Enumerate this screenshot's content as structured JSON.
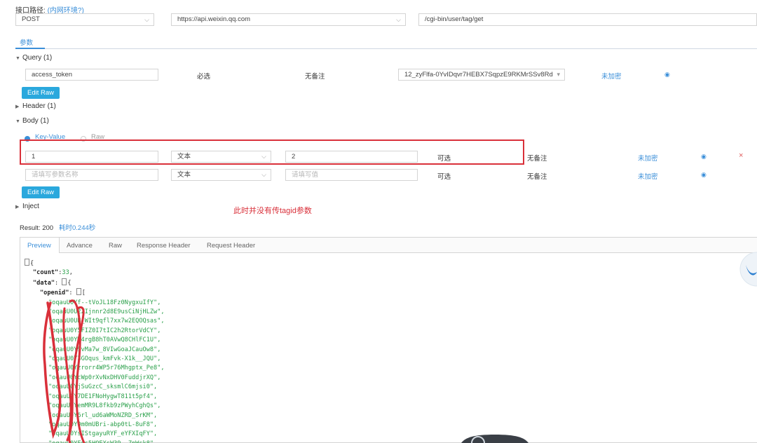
{
  "header": {
    "path_label": "接口路径:",
    "path_hint": "(内网环境?)",
    "method": "POST",
    "host": "https://api.weixin.qq.com",
    "path": "/cgi-bin/user/tag/get"
  },
  "tabs": {
    "params": "参数"
  },
  "query": {
    "title": "Query (1)",
    "param_name": "access_token",
    "required": "必选",
    "remark": "无备注",
    "value": "12_zyFlfa-0YvIDqvr7HEBX7SqpzE9RKMrSSv8Rd",
    "encrypt": "未加密",
    "edit_raw": "Edit Raw"
  },
  "header_section": {
    "title": "Header (1)"
  },
  "body": {
    "title": "Body (1)",
    "mode_kv": "Key-Value",
    "mode_raw": "Raw",
    "rows": [
      {
        "key": "1",
        "type": "文本",
        "value": "2",
        "optional": "可选",
        "remark": "无备注",
        "encrypt": "未加密",
        "delete": "×"
      }
    ],
    "empty_row": {
      "key_placeholder": "请填写参数名称",
      "type": "文本",
      "value_placeholder": "请填写值",
      "optional": "可选",
      "remark": "无备注",
      "encrypt": "未加密"
    },
    "edit_raw": "Edit Raw"
  },
  "inject": {
    "title": "Inject"
  },
  "annotation": "此时并没有传tagid参数",
  "result": {
    "label": "Result:",
    "code": "200",
    "time": "耗时0.244秒"
  },
  "panel_tabs": [
    "Preview",
    "Advance",
    "Raw",
    "Response Header",
    "Request Header"
  ],
  "response": {
    "count_key": "\"count\"",
    "count_value": "33",
    "data_key": "\"data\"",
    "openid_key": "\"openid\"",
    "openids": [
      "\"oqauU0Yf--tVoJL18Fz0NygxuIfY\",",
      "\"oqauU0U2ZIjnnr2d8E9usCiNjHLZw\",",
      "\"oqauU0UB_WIt9qfl7xx7w2EQOQsas\",",
      "\"oqauU0Y5FIZ0I7tIC2h2RtorVdCY\",",
      "\"oqauU0YM4rgB8hT0AVwQ8CHlFC1U\",",
      "\"oqauU0Y9vMa7w_8VIwGoaJCauOw8\",",
      "\"oqauU0Y3GOqus_kmFvk-X1k__JQU\",",
      "\"oqauU0Yzrorr4WP5r76Mhgptx_Pe8\",",
      "\"oqauU0YcWp0rXvNxDHV0FuddjrXQ\",",
      "\"oqauU0YjSuGzcC_sksmlC6mjsi0\",",
      "\"oqauU0Y7DE1FNoHygwT811t5pf4\",",
      "\"oqauU0YemMR9L8fkb9zPWyhCghQs\",",
      "\"oqauU0Y6rl_ud6aWMoNZRD_SrKM\",",
      "\"oqauU0Y0m0mUBri-abp0tL-8uF8\",",
      "\"oqauU0YsIStgayuRYF_eYFXIqFY\",",
      "\"oqauU0YFns5HOEXsW39-_ZpWsk8\","
    ]
  },
  "colors": {
    "accent": "#3b8fd9",
    "button": "#2aa8dd",
    "annotation_red": "#d9303a",
    "json_green": "#2aa04a"
  }
}
